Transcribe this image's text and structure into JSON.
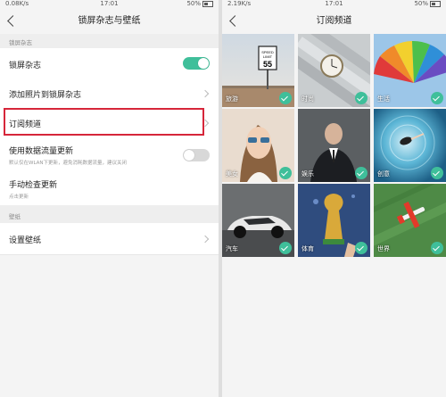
{
  "left_screen": {
    "status": {
      "left": "0.08K/s",
      "time": "17:01",
      "battery": "50%"
    },
    "title": "锁屏杂志与壁纸",
    "section1_label": "锁屏杂志",
    "rows": {
      "lock_magazine": "锁屏杂志",
      "add_photos": "添加照片到锁屏杂志",
      "subscribed_channels": "订阅频道",
      "mobile_data_update": "使用数据流量更新",
      "mobile_data_sub": "默认仅在WLAN下更新，避免消耗数据流量，建议关闭",
      "manual_update": "手动检查更新",
      "manual_update_sub": "点击更新"
    },
    "toggles": {
      "lock_magazine": "on",
      "mobile_data_update": "off"
    },
    "section2_label": "壁纸",
    "wallpaper_row": "设置壁纸"
  },
  "right_screen": {
    "status": {
      "left": "2.19K/s",
      "time": "17:01",
      "battery": "50%"
    },
    "title": "订阅频道",
    "channels": [
      {
        "label": "旅游",
        "subscribed": true,
        "icon": "speed-limit-sign"
      },
      {
        "label": "时尚",
        "subscribed": true,
        "icon": "wristwatch"
      },
      {
        "label": "生活",
        "subscribed": true,
        "icon": "rainbow-umbrella"
      },
      {
        "label": "美女",
        "subscribed": true,
        "icon": "woman-sunglasses"
      },
      {
        "label": "娱乐",
        "subscribed": true,
        "icon": "man-in-suit"
      },
      {
        "label": "创意",
        "subscribed": true,
        "icon": "swimmer-vortex"
      },
      {
        "label": "汽车",
        "subscribed": true,
        "icon": "sports-car"
      },
      {
        "label": "体育",
        "subscribed": true,
        "icon": "world-cup-trophy"
      },
      {
        "label": "世界",
        "subscribed": true,
        "icon": "airplane"
      }
    ]
  },
  "colors": {
    "accent": "#3fbf9a",
    "highlight": "#d6263a"
  }
}
